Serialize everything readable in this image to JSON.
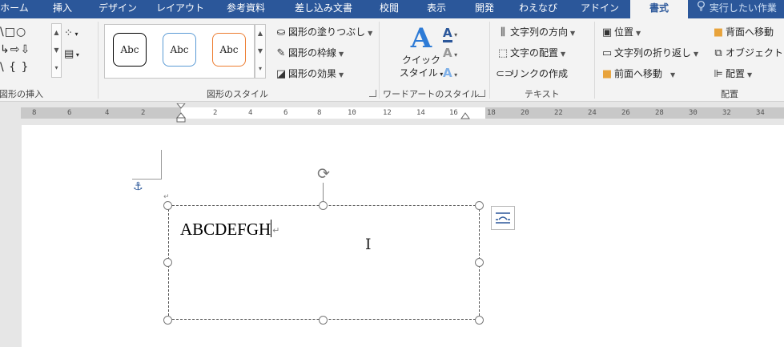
{
  "tabs": [
    {
      "label": "ホーム",
      "active": false
    },
    {
      "label": "挿入",
      "active": false
    },
    {
      "label": "デザイン",
      "active": false
    },
    {
      "label": "レイアウト",
      "active": false
    },
    {
      "label": "参考資料",
      "active": false
    },
    {
      "label": "差し込み文書",
      "active": false
    },
    {
      "label": "校閲",
      "active": false
    },
    {
      "label": "表示",
      "active": false
    },
    {
      "label": "開発",
      "active": false
    },
    {
      "label": "わえなび",
      "active": false
    },
    {
      "label": "アドイン",
      "active": false
    },
    {
      "label": "書式",
      "active": true
    }
  ],
  "tell_me": "実行したい作業",
  "groups": {
    "insert_shapes": {
      "label": "図形の挿入",
      "shape_rows": [
        "\\□○",
        "↳⇨⇩",
        "\\ { }"
      ]
    },
    "shape_styles": {
      "label": "図形のスタイル",
      "presets": [
        "Abc",
        "Abc",
        "Abc"
      ],
      "fill": "図形の塗りつぶし",
      "outline": "図形の枠線",
      "effects": "図形の効果"
    },
    "wordart": {
      "label": "ワードアートのスタイル",
      "quick_style_line1": "クイック",
      "quick_style_line2": "スタイル"
    },
    "text": {
      "label": "テキスト",
      "direction": "文字列の方向",
      "align": "文字の配置",
      "link": "リンクの作成"
    },
    "arrange": {
      "label": "配置",
      "position": "位置",
      "wrap": "文字列の折り返し",
      "bring_forward": "前面へ移動",
      "send_backward": "背面へ移動",
      "selection_pane": "オブジェクトの選",
      "align": "配置"
    }
  },
  "ruler": {
    "left_ticks": [
      "8",
      "6",
      "4",
      "2"
    ],
    "right_ticks": [
      "2",
      "4",
      "6",
      "8",
      "10",
      "12",
      "14",
      "16",
      "18",
      "20",
      "22",
      "24",
      "26",
      "28",
      "30",
      "32",
      "34"
    ]
  },
  "textbox": {
    "text": "ABCDEFGH"
  },
  "colors": {
    "tab_bar": "#2b579a",
    "ribbon_bg": "#f3f3f3",
    "preset_1_border": "#000000",
    "preset_2_border": "#5b9bd5",
    "preset_3_border": "#ed7d31",
    "wordart_blue": "#2e7bd6"
  }
}
